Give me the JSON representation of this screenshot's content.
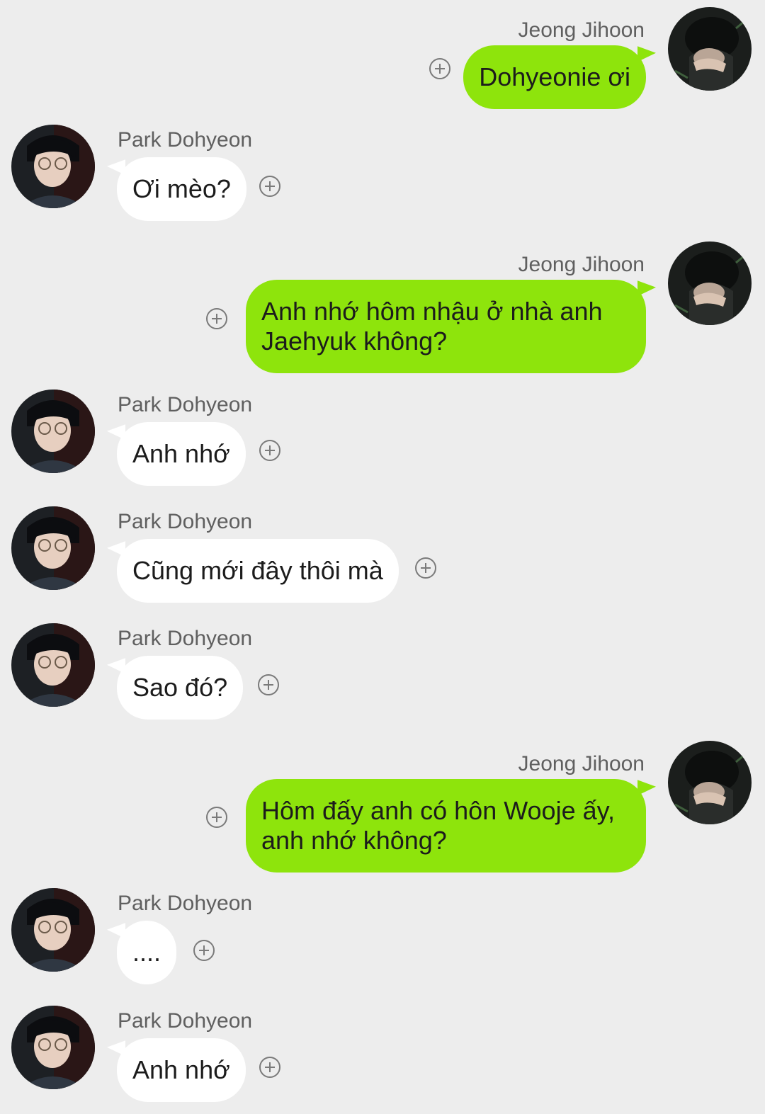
{
  "chat": {
    "participants": {
      "me": "Jeong Jihoon",
      "other": "Park Dohyeon"
    },
    "messages": [
      {
        "sender": "Jeong Jihoon",
        "text": "Dohyeonie ơi"
      },
      {
        "sender": "Park Dohyeon",
        "text": "Ơi mèo?"
      },
      {
        "sender": "Jeong Jihoon",
        "text_line1": "Anh nhớ hôm nhậu ở nhà anh",
        "text_line2": "Jaehyuk không?"
      },
      {
        "sender": "Park Dohyeon",
        "text": "Anh nhớ"
      },
      {
        "sender": "Park Dohyeon",
        "text": "Cũng mới đây thôi mà"
      },
      {
        "sender": "Park Dohyeon",
        "text": "Sao đó?"
      },
      {
        "sender": "Jeong Jihoon",
        "text_line1": "Hôm đấy anh có hôn Wooje ấy,",
        "text_line2": "anh nhớ không?"
      },
      {
        "sender": "Park Dohyeon",
        "text": "...."
      },
      {
        "sender": "Park Dohyeon",
        "text": "Anh nhớ"
      }
    ],
    "colors": {
      "background": "#ededed",
      "outgoing_bubble": "#8ee40c",
      "incoming_bubble": "#ffffff",
      "name_text": "#5f5f5f"
    },
    "icons": {
      "add": "plus-circle-icon"
    }
  }
}
